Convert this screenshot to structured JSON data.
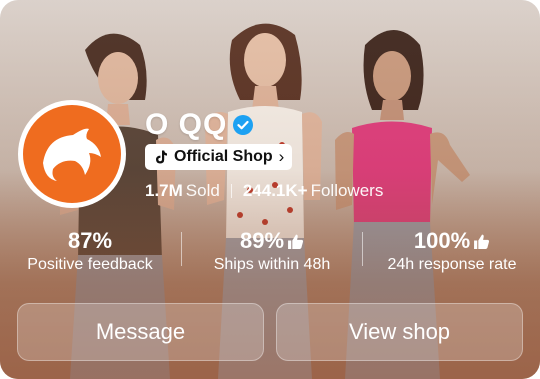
{
  "shop": {
    "name": "O QQ",
    "badge_label": "Official Shop"
  },
  "stats": {
    "sold_count": "1.7M",
    "sold_label": "Sold",
    "followers_count": "244.1K+",
    "followers_label": "Followers"
  },
  "metrics": [
    {
      "value": "87%",
      "label": "Positive feedback"
    },
    {
      "value": "89%",
      "label": "Ships within 48h"
    },
    {
      "value": "100%",
      "label": "24h response rate"
    }
  ],
  "actions": {
    "message_label": "Message",
    "view_shop_label": "View shop"
  },
  "colors": {
    "logo_bg": "#ef6c1f",
    "verified": "#1da1f2"
  },
  "icons": {
    "logo": "dolphin-icon",
    "verified": "verified-check-icon",
    "platform": "tiktok-icon",
    "badge_arrow": "chevron-right-icon",
    "thumb": "thumbs-up-icon"
  }
}
